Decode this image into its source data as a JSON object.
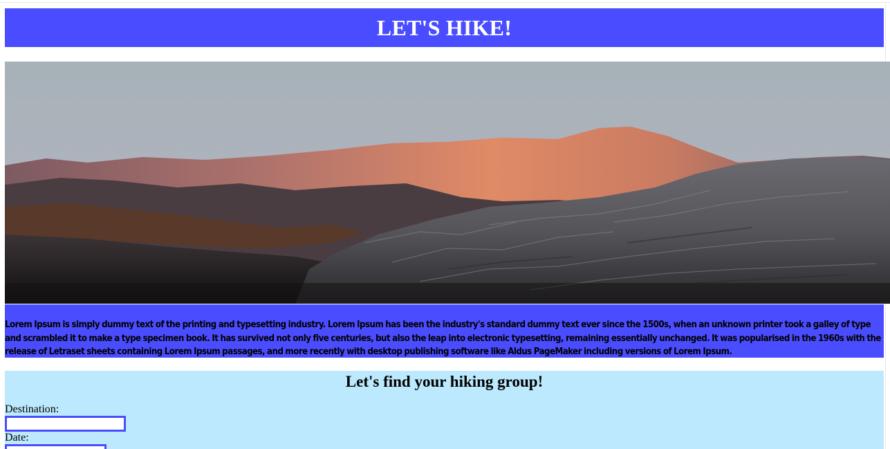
{
  "header": {
    "title": "LET'S HIKE!"
  },
  "colors": {
    "accent": "#4a4dff",
    "form_background": "#bce9fd"
  },
  "hero": {
    "subject": "mountain ridge at sunset"
  },
  "intro": {
    "text": "Lorem Ipsum is simply dummy text of the printing and typesetting industry. Lorem Ipsum has been the industry's standard dummy text ever since the 1500s, when an unknown printer took a galley of type and scrambled it to make a type specimen book. It has survived not only five centuries, but also the leap into electronic typesetting, remaining essentially unchanged. It was popularised in the 1960s with the release of Letraset sheets containing Lorem Ipsum passages, and more recently with desktop publishing software like Aldus PageMaker including versions of Lorem Ipsum."
  },
  "form": {
    "heading": "Let's find your hiking group!",
    "destination_label": "Destination:",
    "destination_value": "",
    "date_label": "Date:",
    "date_value": ""
  }
}
